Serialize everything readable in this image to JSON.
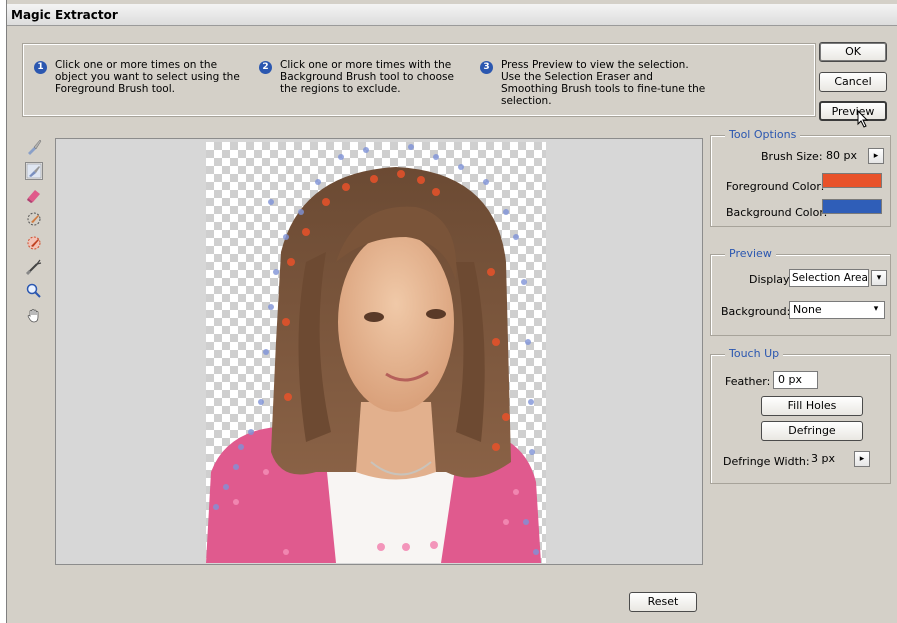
{
  "window": {
    "title": "Magic Extractor"
  },
  "instructions": [
    {
      "number": "1",
      "text": "Click one or more times on the object you want to select using the Foreground Brush tool."
    },
    {
      "number": "2",
      "text": "Click one or more times with the Background Brush tool to choose the regions to exclude."
    },
    {
      "number": "3",
      "text": "Press Preview to view the selection. Use the Selection Eraser and Smoothing Brush tools to fine-tune the selection."
    }
  ],
  "buttons": {
    "ok": "OK",
    "cancel": "Cancel",
    "preview": "Preview",
    "reset": "Reset"
  },
  "tools": [
    "foreground-brush-icon",
    "background-brush-icon",
    "point-eraser-icon",
    "add-to-selection-icon",
    "remove-from-selection-icon",
    "smoothing-brush-icon",
    "zoom-icon",
    "hand-icon"
  ],
  "tool_options": {
    "title": "Tool Options",
    "brush_size_label": "Brush Size:",
    "brush_size_value": "80 px",
    "foreground_label": "Foreground Color:",
    "foreground_color": "#e8522a",
    "background_label": "Background Color:",
    "background_color": "#2f5eb8"
  },
  "preview": {
    "title": "Preview",
    "display_label": "Display:",
    "display_value": "Selection Area",
    "background_label": "Background:",
    "background_value": "None"
  },
  "touch_up": {
    "title": "Touch Up",
    "feather_label": "Feather:",
    "feather_value": "0 px",
    "fill_holes": "Fill Holes",
    "defringe": "Defringe",
    "defringe_width_label": "Defringe Width:",
    "defringe_width_value": "3 px"
  }
}
